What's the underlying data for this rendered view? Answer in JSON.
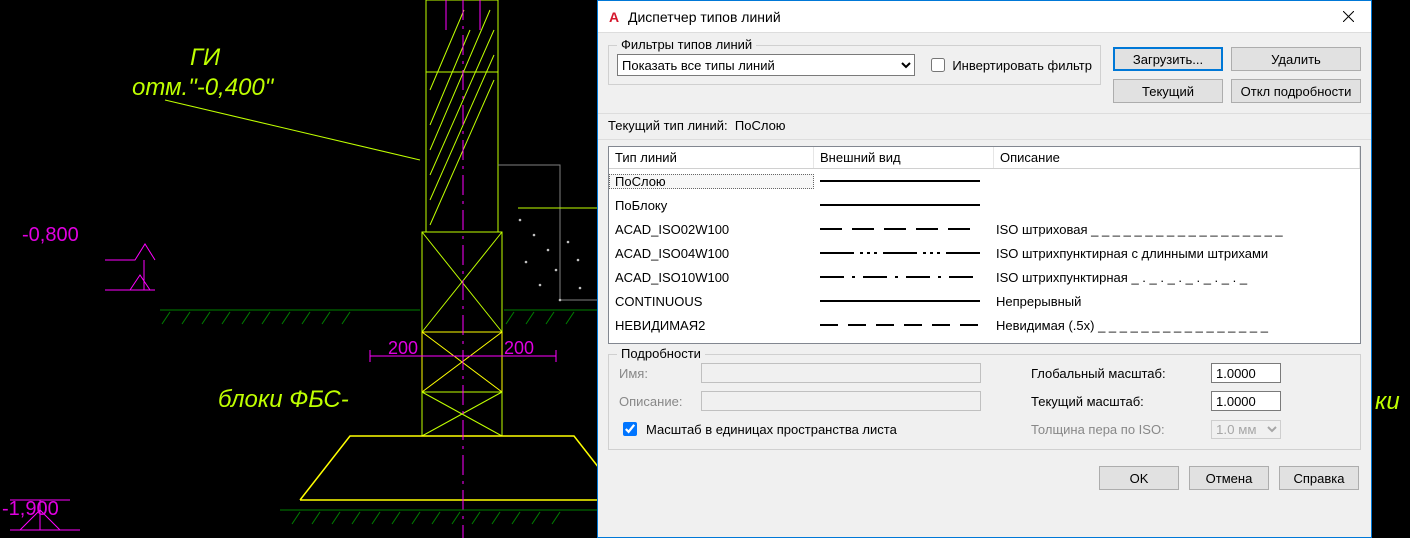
{
  "cad": {
    "label_gi": "ГИ",
    "label_mark": "отм.\"-0,400\"",
    "dim_neg0800": "-0,800",
    "dim_200a": "200",
    "dim_200b": "200",
    "label_blocks": "блоки ФБС-",
    "dim_neg1900": "-1,900",
    "label_right": "ки"
  },
  "dialog": {
    "title": "Диспетчер типов линий",
    "filters_legend": "Фильтры типов линий",
    "filter_selected": "Показать все типы линий",
    "invert_label": "Инвертировать фильтр",
    "btn_load": "Загрузить...",
    "btn_delete": "Удалить",
    "btn_current": "Текущий",
    "btn_toggle_details": "Откл подробности",
    "current_prefix": "Текущий тип линий:",
    "current_value": "ПоСлою",
    "headers": {
      "name": "Тип линий",
      "appearance": "Внешний вид",
      "desc": "Описание"
    },
    "rows": [
      {
        "name": "ПоСлою",
        "pattern": "solid",
        "desc": ""
      },
      {
        "name": "ПоБлоку",
        "pattern": "solid",
        "desc": ""
      },
      {
        "name": "ACAD_ISO02W100",
        "pattern": "dash",
        "desc": "ISO штриховая _ _ _ _ _ _ _ _ _ _ _ _ _ _ _ _ _ _"
      },
      {
        "name": "ACAD_ISO04W100",
        "pattern": "dashdot3",
        "desc": "ISO штрихпунктирная с длинными штрихами"
      },
      {
        "name": "ACAD_ISO10W100",
        "pattern": "dashdot",
        "desc": "ISO штрихпунктирная _ . _ . _ . _ . _ . _ . _"
      },
      {
        "name": "CONTINUOUS",
        "pattern": "solid",
        "desc": "Непрерывный"
      },
      {
        "name": "НЕВИДИМАЯ2",
        "pattern": "hidden",
        "desc": "Невидимая (.5x) _ _ _ _ _ _ _ _ _ _ _ _ _ _ _ _"
      }
    ],
    "selected_row_index": 0,
    "details": {
      "legend": "Подробности",
      "name_label": "Имя:",
      "name_value": "",
      "desc_label": "Описание:",
      "desc_value": "",
      "paperscale_label": "Масштаб в единицах пространства листа",
      "paperscale_checked": true,
      "global_scale_label": "Глобальный масштаб:",
      "global_scale_value": "1.0000",
      "current_scale_label": "Текущий масштаб:",
      "current_scale_value": "1.0000",
      "iso_pen_label": "Толщина пера по ISO:",
      "iso_pen_value": "1.0 мм"
    },
    "btn_ok": "OK",
    "btn_cancel": "Отмена",
    "btn_help": "Справка"
  }
}
